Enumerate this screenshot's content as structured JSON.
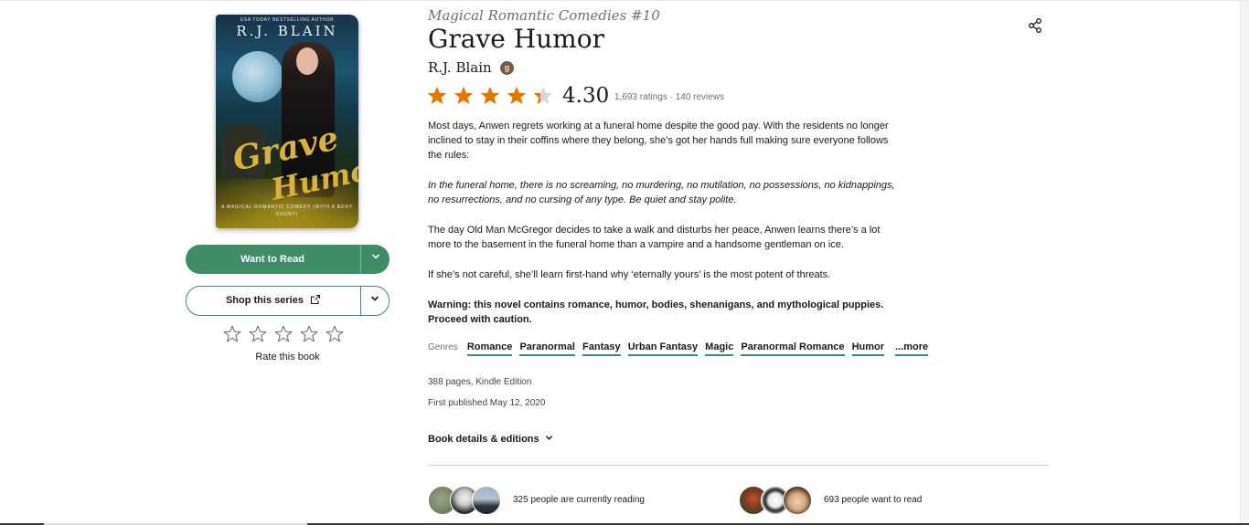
{
  "cover": {
    "tagline": "USA TODAY BESTSELLING AUTHOR",
    "author": "R.J. BLAIN",
    "title_line1": "Grave",
    "title_line2": "Humor",
    "subtitle": "A MAGICAL ROMANTIC COMEDY (WITH A BODY COUNT)"
  },
  "actions": {
    "want_to_read": "Want to Read",
    "shop": "Shop this series",
    "rate_label": "Rate this book"
  },
  "book": {
    "series": "Magical Romantic Comedies #10",
    "title": "Grave Humor",
    "author": "R.J. Blain",
    "average_rating": "4.30",
    "rating_value": 4.3,
    "counts": "1,693 ratings · 140 reviews",
    "description": [
      "Most days, Anwen regrets working at a funeral home despite the good pay. With the residents no longer inclined to stay in their coffins where they belong, she’s got her hands full making sure everyone follows the rules:",
      "In the funeral home, there is no screaming, no murdering, no mutilation, no possessions, no kidnappings, no resurrections, and no cursing of any type. Be quiet and stay polite.",
      "The day Old Man McGregor decides to take a walk and disturbs her peace, Anwen learns there’s a lot more to the basement in the funeral home than a vampire and a handsome gentleman on ice.",
      "If she’s not careful, she’ll learn first-hand why ‘eternally yours’ is the most potent of threats.",
      "Warning: this novel contains romance, humor, bodies, shenanigans, and mythological puppies. Proceed with caution."
    ],
    "genres_label": "Genres",
    "genres": [
      "Romance",
      "Paranormal",
      "Fantasy",
      "Urban Fantasy",
      "Magic",
      "Paranormal Romance",
      "Humor"
    ],
    "genres_more": "...more",
    "pages": "388 pages, Kindle Edition",
    "published": "First published May 12, 2020",
    "details_link": "Book details & editions"
  },
  "social": {
    "currently_reading": "325 people are currently reading",
    "want_to_read": "693 people want to read"
  },
  "colors": {
    "accent": "#3f8d66",
    "star": "#e87400",
    "star_empty": "#d8d8d8",
    "text": "#1e1915"
  }
}
